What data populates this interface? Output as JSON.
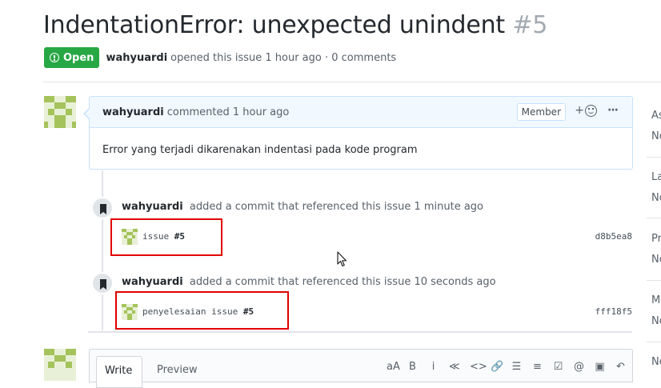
{
  "issue": {
    "title": "IndentationError: unexpected unindent",
    "number": "#5",
    "state": "Open",
    "author": "wahyuardi",
    "meta": "opened this issue 1 hour ago · 0 comments"
  },
  "comment": {
    "author": "wahyuardi",
    "time": "commented 1 hour ago",
    "role_badge": "Member",
    "reaction_plus": "+",
    "more": "···",
    "body": "Error yang terjadi dikarenakan indentasi pada kode program"
  },
  "events": [
    {
      "actor": "wahyuardi",
      "text": "added a commit that referenced this issue 1 minute ago",
      "commit_message": "issue",
      "commit_ref": "#5",
      "sha": "d8b5ea8"
    },
    {
      "actor": "wahyuardi",
      "text": "added a commit that referenced this issue 10 seconds ago",
      "commit_message": "penyelesaian issue",
      "commit_ref": "#5",
      "sha": "fff18f5"
    }
  ],
  "editor": {
    "write_tab": "Write",
    "preview_tab": "Preview",
    "toolbar": [
      "aA",
      "B",
      "i",
      "≪",
      "<>",
      "🔗",
      "☰",
      "≡",
      "☑",
      "@",
      "▣",
      "↶"
    ]
  },
  "sidebar": {
    "items": [
      {
        "head": "As",
        "value": "No"
      },
      {
        "head": "La",
        "value": "No"
      },
      {
        "head": "Pr",
        "value": "No"
      },
      {
        "head": "M",
        "value": "No"
      },
      {
        "head": "No",
        "value": ""
      }
    ]
  },
  "colors": {
    "open_green": "#28a745",
    "highlight_red": "#e00000",
    "comment_border": "#c8e1ff"
  },
  "icons": [
    "issue-opened-icon",
    "smiley-icon",
    "bookmark-icon",
    "mouse-pointer-icon"
  ]
}
